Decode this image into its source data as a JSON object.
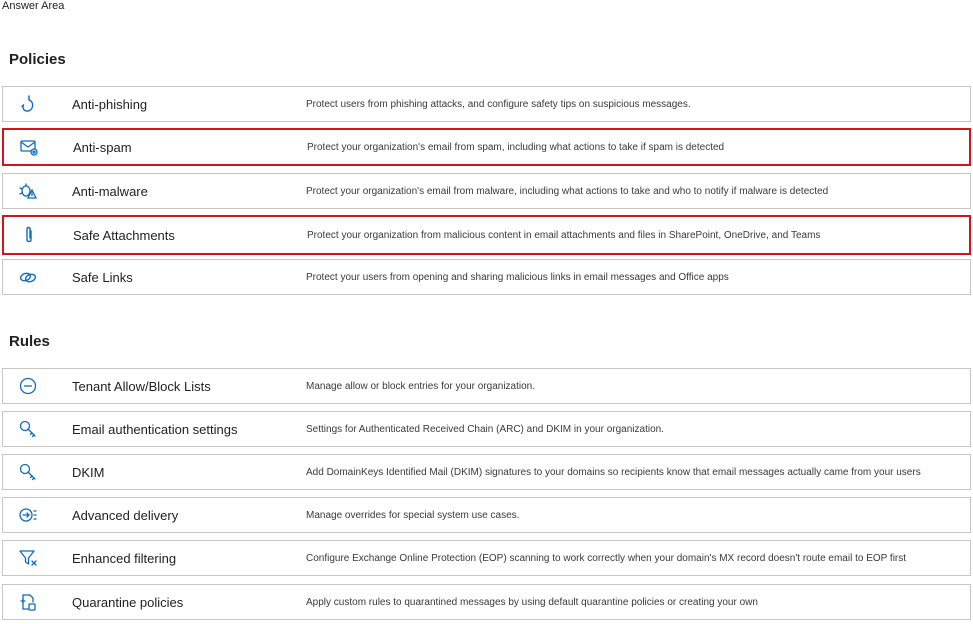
{
  "header": {
    "answer_area": "Answer Area"
  },
  "policies": {
    "title": "Policies",
    "items": [
      {
        "icon": "anti-phishing-icon",
        "name": "Anti-phishing",
        "description": "Protect users from phishing attacks, and configure safety tips on suspicious messages.",
        "highlighted": false
      },
      {
        "icon": "mail-gear-icon",
        "name": "Anti-spam",
        "description": "Protect your organization's email from spam, including what actions to take if spam is detected",
        "highlighted": true
      },
      {
        "icon": "bug-warning-icon",
        "name": "Anti-malware",
        "description": "Protect your organization's email from malware, including what actions to take and who to notify if malware is detected",
        "highlighted": false
      },
      {
        "icon": "paperclip-icon",
        "name": "Safe Attachments",
        "description": "Protect your organization from malicious content in email attachments and files in SharePoint, OneDrive, and Teams",
        "highlighted": true
      },
      {
        "icon": "link-icon",
        "name": "Safe Links",
        "description": "Protect your users from opening and sharing malicious links in email messages and Office apps",
        "highlighted": false
      }
    ]
  },
  "rules": {
    "title": "Rules",
    "items": [
      {
        "icon": "block-icon",
        "name": "Tenant Allow/Block Lists",
        "description": "Manage allow or block entries for your organization."
      },
      {
        "icon": "key-icon",
        "name": "Email authentication settings",
        "description": "Settings for Authenticated Received Chain (ARC) and DKIM in your organization."
      },
      {
        "icon": "key-icon",
        "name": "DKIM",
        "description": "Add DomainKeys Identified Mail (DKIM) signatures to your domains so recipients know that email messages actually came from your users"
      },
      {
        "icon": "delivery-icon",
        "name": "Advanced delivery",
        "description": "Manage overrides for special system use cases."
      },
      {
        "icon": "filter-icon",
        "name": "Enhanced filtering",
        "description": "Configure Exchange Online Protection (EOP) scanning to work correctly when your domain's MX record doesn't route email to EOP first"
      },
      {
        "icon": "quarantine-icon",
        "name": "Quarantine policies",
        "description": "Apply custom rules to quarantined messages by using default quarantine policies or creating your own"
      }
    ]
  },
  "colors": {
    "highlight": "#d6131b",
    "icon": "#0f6cbd",
    "border": "#c8c6c4"
  }
}
